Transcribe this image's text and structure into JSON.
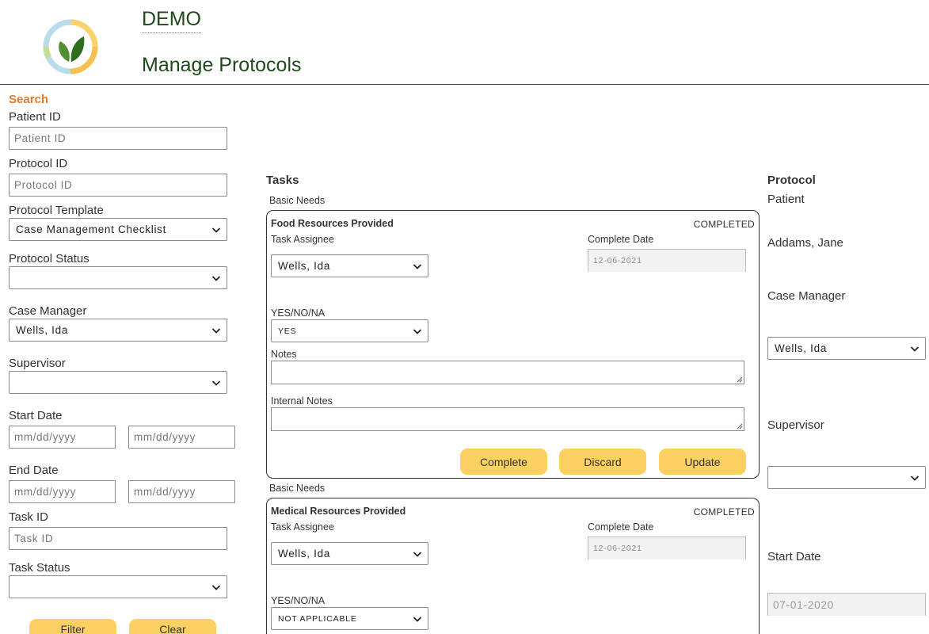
{
  "header": {
    "brand": "DEMO",
    "title": "Manage Protocols"
  },
  "search": {
    "heading": "Search",
    "patient_id": {
      "label": "Patient ID",
      "placeholder": "Patient ID"
    },
    "protocol_id": {
      "label": "Protocol ID",
      "placeholder": "Protocol ID"
    },
    "protocol_template": {
      "label": "Protocol Template",
      "value": "Case Management Checklist"
    },
    "protocol_status": {
      "label": "Protocol Status",
      "value": ""
    },
    "case_manager": {
      "label": "Case Manager",
      "value": "Wells, Ida"
    },
    "supervisor": {
      "label": "Supervisor",
      "value": ""
    },
    "start_date": {
      "label": "Start Date",
      "from_placeholder": "mm/dd/yyyy",
      "to_placeholder": "mm/dd/yyyy"
    },
    "end_date": {
      "label": "End Date",
      "from_placeholder": "mm/dd/yyyy",
      "to_placeholder": "mm/dd/yyyy"
    },
    "task_id": {
      "label": "Task ID",
      "placeholder": "Task ID"
    },
    "task_status": {
      "label": "Task Status",
      "value": ""
    },
    "filter_label": "Filter",
    "clear_label": "Clear"
  },
  "tasks": {
    "heading": "Tasks",
    "items": [
      {
        "group": "Basic Needs",
        "title": "Food Resources Provided",
        "status": "COMPLETED",
        "assignee_label": "Task Assignee",
        "assignee": "Wells, Ida",
        "complete_date_label": "Complete Date",
        "complete_date": "12-06-2021",
        "answer_label": "YES/NO/NA",
        "answer": "YES",
        "notes_label": "Notes",
        "internal_notes_label": "Internal Notes",
        "complete_label": "Complete",
        "discard_label": "Discard",
        "update_label": "Update"
      },
      {
        "group": "Basic Needs",
        "title": "Medical Resources Provided",
        "status": "COMPLETED",
        "assignee_label": "Task Assignee",
        "assignee": "Wells, Ida",
        "complete_date_label": "Complete Date",
        "complete_date": "12-06-2021",
        "answer_label": "YES/NO/NA",
        "answer": "NOT APPLICABLE"
      }
    ]
  },
  "protocol": {
    "heading": "Protocol",
    "patient_label": "Patient",
    "patient_name": "Addams, Jane",
    "case_manager_label": "Case Manager",
    "case_manager": "Wells, Ida",
    "supervisor_label": "Supervisor",
    "supervisor": "",
    "start_date_label": "Start Date",
    "start_date": "07-01-2020"
  },
  "colors": {
    "accent_orange": "#e07a2a",
    "title_green": "#1f4a1c",
    "button_yellow": "#fdd161"
  }
}
